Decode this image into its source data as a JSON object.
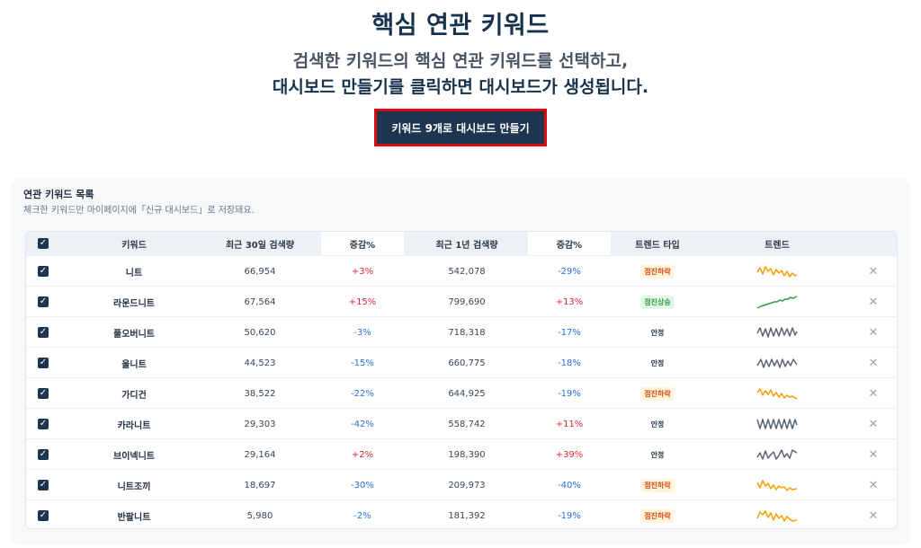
{
  "hero": {
    "title": "핵심 연관 키워드",
    "subtitle_line1": "검색한 키워드의 핵심 연관 키워드를 선택하고,",
    "subtitle_line2": "대시보드 만들기를 클릭하면 대시보드가 생성됩니다.",
    "cta_label": "키워드 9개로 대시보드 만들기"
  },
  "panel": {
    "title": "연관 키워드 목록",
    "description": "체크한 키워드만 마이페이지에「신규 대시보드」로 저장돼요."
  },
  "table": {
    "headers": {
      "keyword": "키워드",
      "recent30": "최근 30일 검색량",
      "change30": "증감%",
      "recent1y": "최근 1년 검색량",
      "change1y": "증감%",
      "trend_type": "트렌드 타입",
      "trend": "트렌드"
    },
    "colors": {
      "down": "#f59f00",
      "up": "#2f9e44",
      "flat": "#5b6675"
    },
    "rows": [
      {
        "keyword": "니트",
        "recent30": "66,954",
        "change30": "+3%",
        "recent1y": "542,078",
        "change1y": "-29%",
        "trend_type": "점진하락",
        "trend_kind": "down"
      },
      {
        "keyword": "라운드니트",
        "recent30": "67,564",
        "change30": "+15%",
        "recent1y": "799,690",
        "change1y": "+13%",
        "trend_type": "점진상승",
        "trend_kind": "up"
      },
      {
        "keyword": "풀오버니트",
        "recent30": "50,620",
        "change30": "-3%",
        "recent1y": "718,318",
        "change1y": "-17%",
        "trend_type": "안정",
        "trend_kind": "flat"
      },
      {
        "keyword": "울니트",
        "recent30": "44,523",
        "change30": "-15%",
        "recent1y": "660,775",
        "change1y": "-18%",
        "trend_type": "안정",
        "trend_kind": "flat"
      },
      {
        "keyword": "가디건",
        "recent30": "38,522",
        "change30": "-22%",
        "recent1y": "644,925",
        "change1y": "-19%",
        "trend_type": "점진하락",
        "trend_kind": "down"
      },
      {
        "keyword": "카라니트",
        "recent30": "29,303",
        "change30": "-42%",
        "recent1y": "558,742",
        "change1y": "+11%",
        "trend_type": "안정",
        "trend_kind": "flat"
      },
      {
        "keyword": "브이넥니트",
        "recent30": "29,164",
        "change30": "+2%",
        "recent1y": "198,390",
        "change1y": "+39%",
        "trend_type": "안정",
        "trend_kind": "flat"
      },
      {
        "keyword": "니트조끼",
        "recent30": "18,697",
        "change30": "-30%",
        "recent1y": "209,973",
        "change1y": "-40%",
        "trend_type": "점진하락",
        "trend_kind": "down"
      },
      {
        "keyword": "반팔니트",
        "recent30": "5,980",
        "change30": "-2%",
        "recent1y": "181,392",
        "change1y": "-19%",
        "trend_type": "점진하락",
        "trend_kind": "down"
      }
    ]
  }
}
